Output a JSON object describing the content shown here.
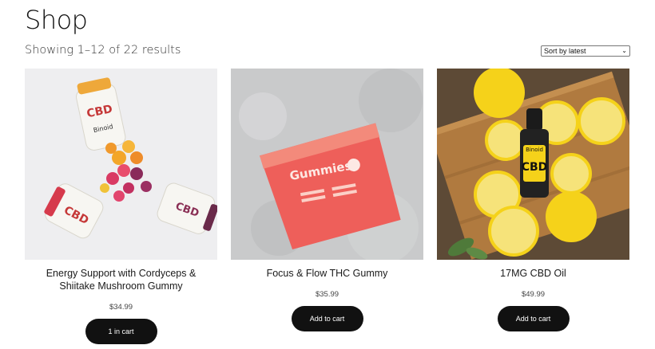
{
  "page": {
    "title": "Shop",
    "result_count": "Showing 1–12 of 22 results",
    "sort": {
      "selected": "Sort by latest"
    }
  },
  "products": [
    {
      "title": "Energy Support with Cordyceps & Shiitake Mushroom Gummy",
      "price": "$34.99",
      "button": "1 in cart",
      "image_text": {
        "brand": "Binoid",
        "label": "CBD"
      }
    },
    {
      "title": "Focus & Flow THC Gummy",
      "price": "$35.99",
      "button": "Add to cart",
      "image_text": {
        "brand": "Gummies"
      }
    },
    {
      "title": "17MG CBD Oil",
      "price": "$49.99",
      "button": "Add to cart",
      "image_text": {
        "brand": "Binoid",
        "label": "CBD"
      }
    }
  ],
  "colors": {
    "button_bg": "#111111",
    "button_text": "#ffffff",
    "accent_red": "#e8453c",
    "lemon": "#f5d21a"
  }
}
